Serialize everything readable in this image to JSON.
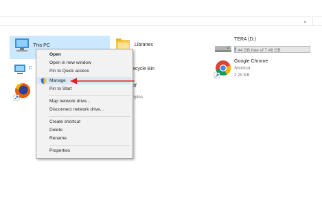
{
  "items": {
    "this_pc": {
      "label": "This PC"
    },
    "libraries": {
      "label": "Libraries"
    },
    "recycle_bin": {
      "label_partial": "ecycle Bin"
    },
    "pdf_file": {
      "label_partial": "df",
      "size_partial": "bytes"
    },
    "tera_drive": {
      "label": "TERA (D:)",
      "free": "7.44 GB free of 7.48 GB",
      "used_fraction": 0.005
    },
    "google_chrome": {
      "label": "Google Chrome",
      "type": "Shortcut",
      "size": "2.20 KB"
    }
  },
  "context_menu": {
    "items": [
      {
        "label": "Open"
      },
      {
        "label": "Open in new window"
      },
      {
        "label": "Pin to Quick access"
      },
      {
        "label": "Manage"
      },
      {
        "label": "Pin to Start"
      },
      {
        "label": "Map network drive..."
      },
      {
        "label": "Disconnect network drive..."
      },
      {
        "label": "Create shortcut"
      },
      {
        "label": "Delete"
      },
      {
        "label": "Rename"
      },
      {
        "label": "Properties"
      }
    ]
  },
  "colors": {
    "selection": "#cce8ff",
    "menu_hover": "#d8e9f5",
    "arrow": "#e02020"
  }
}
